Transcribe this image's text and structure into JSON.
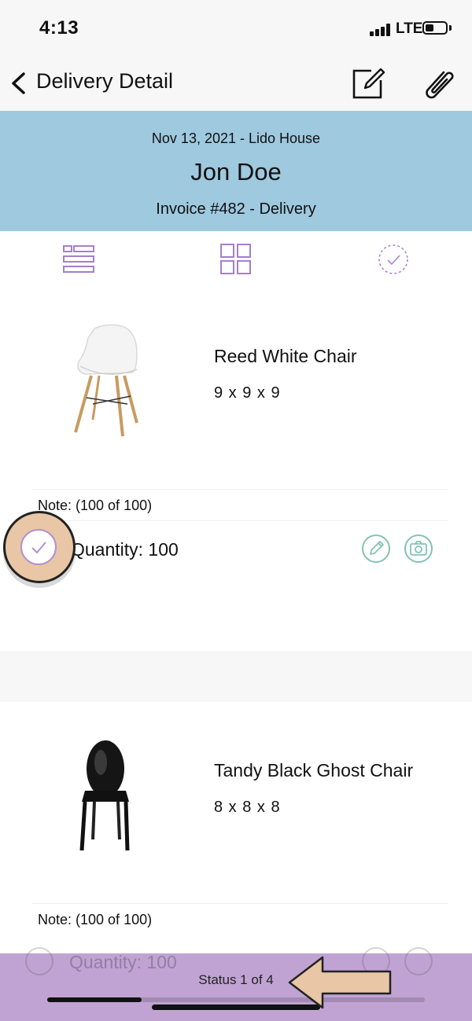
{
  "status_bar": {
    "time": "4:13",
    "network": "LTE"
  },
  "nav": {
    "title": "Delivery Detail"
  },
  "header": {
    "date_location": "Nov 13, 2021 - Lido House",
    "customer": "Jon Doe",
    "invoice": "Invoice #482 - Delivery"
  },
  "items": [
    {
      "name": "Reed White Chair",
      "dimensions": "9 x 9 x 9",
      "note": "Note:  (100 of 100)",
      "quantity": "Quantity: 100"
    },
    {
      "name": "Tandy Black Ghost Chair",
      "dimensions": "8 x 8 x 8",
      "note": "Note:  (100 of 100)",
      "quantity": "Quantity: 100"
    }
  ],
  "footer": {
    "status": "Status 1 of 4",
    "progress": 0.25
  },
  "colors": {
    "header_bg": "#9ec9df",
    "accent_purple": "#a47fce",
    "accent_teal": "#84c2b2",
    "overlay": "#bea0d2",
    "callout": "#e8c6a6"
  },
  "icons": [
    "back-chevron-icon",
    "compose-icon",
    "paperclip-icon",
    "list-view-icon",
    "grid-view-icon",
    "check-view-icon",
    "check-icon",
    "pencil-icon",
    "camera-icon",
    "arrow-icon"
  ]
}
